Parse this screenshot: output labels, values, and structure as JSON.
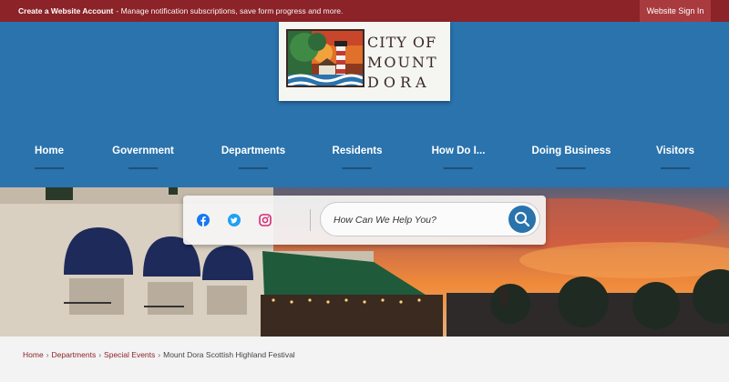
{
  "topbar": {
    "create_account": "Create a Website Account",
    "message": "- Manage notification subscriptions, save form progress and more.",
    "sign_in": "Website Sign In"
  },
  "logo": {
    "line1": "CITY OF",
    "line2": "MOUNT",
    "line3": "DORA"
  },
  "nav": {
    "items": [
      {
        "label": "Home"
      },
      {
        "label": "Government"
      },
      {
        "label": "Departments"
      },
      {
        "label": "Residents"
      },
      {
        "label": "How Do I..."
      },
      {
        "label": "Doing Business"
      },
      {
        "label": "Visitors"
      }
    ]
  },
  "social": {
    "icons": [
      "facebook-icon",
      "twitter-icon",
      "instagram-icon"
    ]
  },
  "search": {
    "placeholder": "How Can We Help You?",
    "icon": "search-icon"
  },
  "breadcrumb": {
    "items": [
      "Home",
      "Departments",
      "Special Events"
    ],
    "separator": "›",
    "current": "Mount Dora Scottish Highland Festival"
  },
  "colors": {
    "topbar": "#8b2328",
    "header": "#2a73ad",
    "link": "#8b2328"
  }
}
